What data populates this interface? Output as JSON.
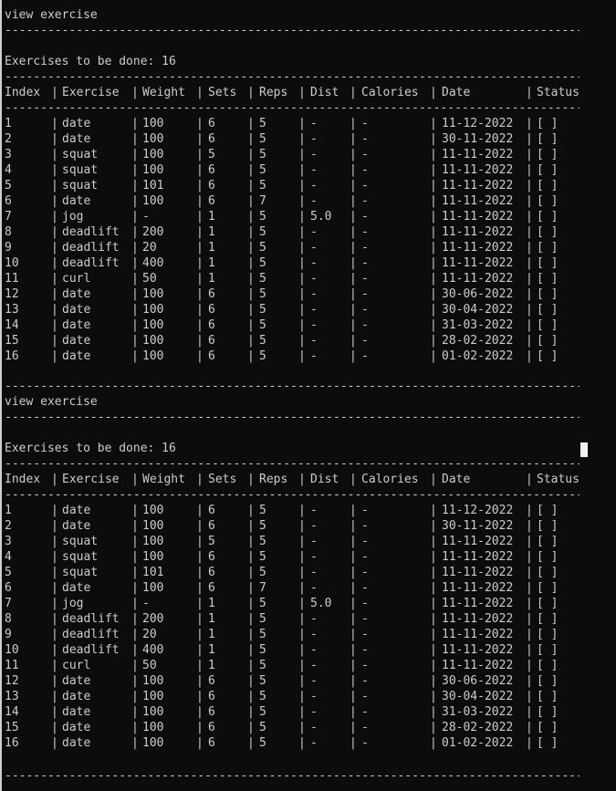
{
  "screen": {
    "title": "view exercise",
    "summary": "Exercises to be done: 16"
  },
  "table": {
    "headers": [
      "Index",
      "Exercise",
      "Weight",
      "Sets",
      "Reps",
      "Dist",
      "Calories",
      "Date",
      "Status"
    ],
    "rows": [
      [
        "1",
        "date",
        "100",
        "6",
        "5",
        "-",
        "-",
        "11-12-2022",
        "[ ]"
      ],
      [
        "2",
        "date",
        "100",
        "6",
        "5",
        "-",
        "-",
        "30-11-2022",
        "[ ]"
      ],
      [
        "3",
        "squat",
        "100",
        "5",
        "5",
        "-",
        "-",
        "11-11-2022",
        "[ ]"
      ],
      [
        "4",
        "squat",
        "100",
        "6",
        "5",
        "-",
        "-",
        "11-11-2022",
        "[ ]"
      ],
      [
        "5",
        "squat",
        "101",
        "6",
        "5",
        "-",
        "-",
        "11-11-2022",
        "[ ]"
      ],
      [
        "6",
        "date",
        "100",
        "6",
        "7",
        "-",
        "-",
        "11-11-2022",
        "[ ]"
      ],
      [
        "7",
        "jog",
        "-",
        "1",
        "5",
        "5.0",
        "-",
        "11-11-2022",
        "[ ]"
      ],
      [
        "8",
        "deadlift",
        "200",
        "1",
        "5",
        "-",
        "-",
        "11-11-2022",
        "[ ]"
      ],
      [
        "9",
        "deadlift",
        "20",
        "1",
        "5",
        "-",
        "-",
        "11-11-2022",
        "[ ]"
      ],
      [
        "10",
        "deadlift",
        "400",
        "1",
        "5",
        "-",
        "-",
        "11-11-2022",
        "[ ]"
      ],
      [
        "11",
        "curl",
        "50",
        "1",
        "5",
        "-",
        "-",
        "11-11-2022",
        "[ ]"
      ],
      [
        "12",
        "date",
        "100",
        "6",
        "5",
        "-",
        "-",
        "30-06-2022",
        "[ ]"
      ],
      [
        "13",
        "date",
        "100",
        "6",
        "5",
        "-",
        "-",
        "30-04-2022",
        "[ ]"
      ],
      [
        "14",
        "date",
        "100",
        "6",
        "5",
        "-",
        "-",
        "31-03-2022",
        "[ ]"
      ],
      [
        "15",
        "date",
        "100",
        "6",
        "5",
        "-",
        "-",
        "28-02-2022",
        "[ ]"
      ],
      [
        "16",
        "date",
        "100",
        "6",
        "5",
        "-",
        "-",
        "01-02-2022",
        "[ ]"
      ]
    ]
  },
  "colors": {
    "background": "#0c0c0c",
    "text": "#cccccc",
    "cursor": "#f2f2f2"
  }
}
